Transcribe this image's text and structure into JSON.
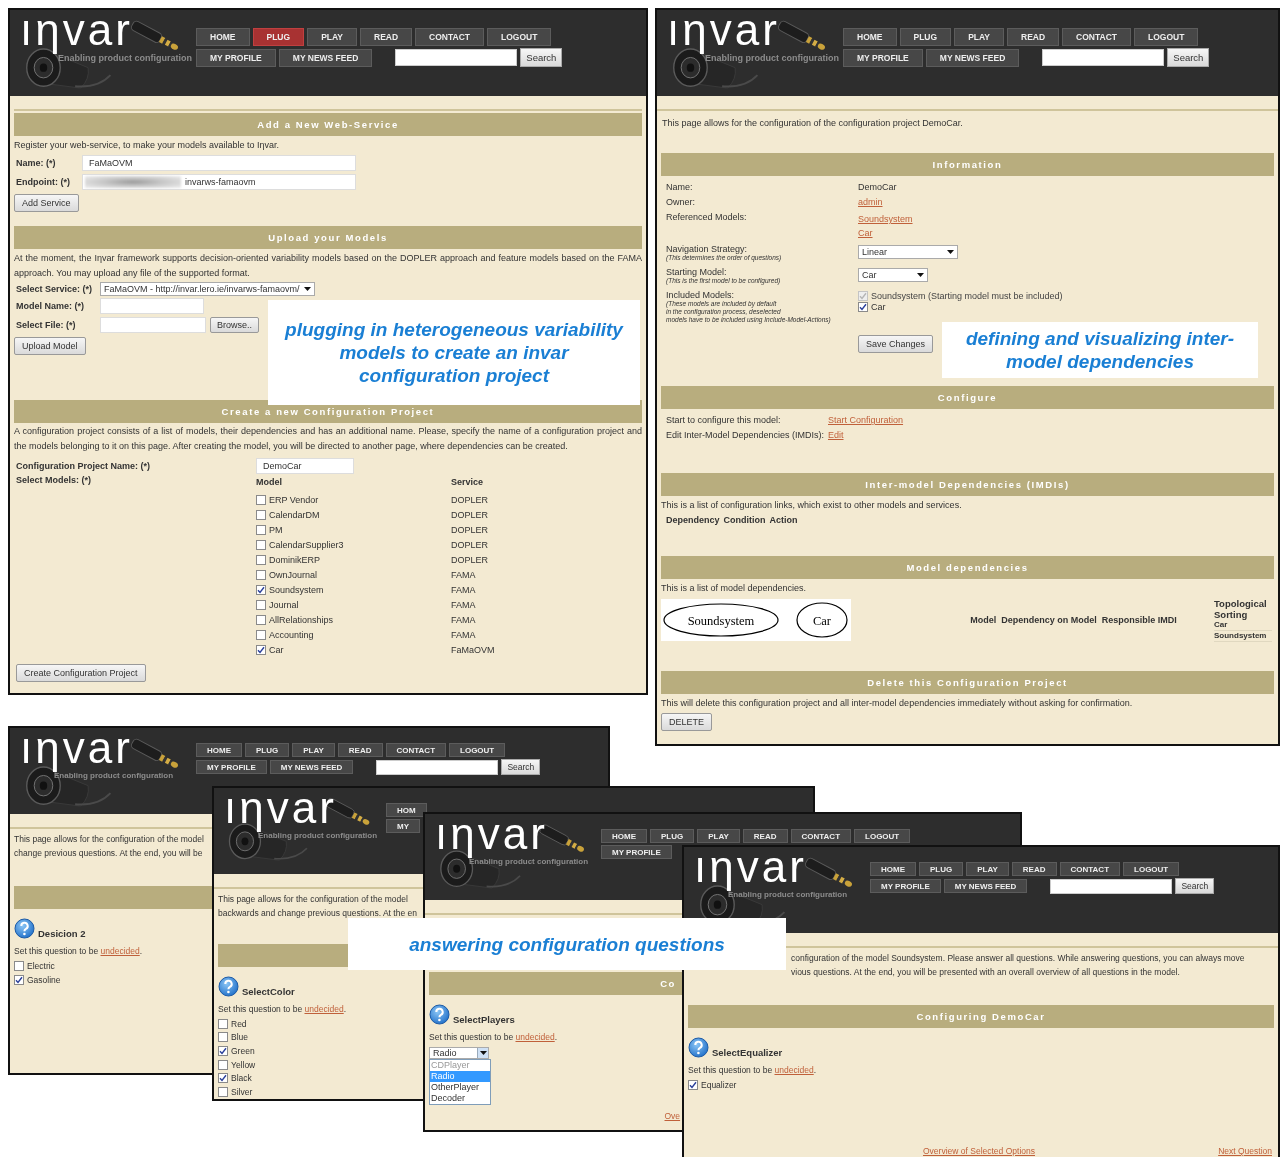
{
  "windows": [
    {
      "kind": "plug",
      "header": {
        "logo": "ıηvar",
        "tagline": "Enabling product configuration",
        "nav_row_1": [
          {
            "label": "HOME",
            "selected": false
          },
          {
            "label": "PLUG",
            "selected": true
          },
          {
            "label": "PLAY",
            "selected": false
          },
          {
            "label": "READ",
            "selected": false
          },
          {
            "label": "CONTACT",
            "selected": false
          },
          {
            "label": "LOGOUT",
            "selected": false
          }
        ],
        "nav_row_2": [
          {
            "label": "MY PROFILE",
            "selected": false
          },
          {
            "label": "MY NEWS FEED",
            "selected": false
          }
        ],
        "search": {
          "button": "Search"
        }
      },
      "add_service": {
        "title": "Add a New Web-Service",
        "text": "Register your web-service, to make your models available to Iηvar.",
        "name_label": "Name: (*)",
        "name_value": "FaMaOVM",
        "endpoint_label": "Endpoint: (*)",
        "endpoint_value": "invarws-famaovm",
        "button": "Add Service"
      },
      "upload": {
        "title": "Upload your Models",
        "text": "At the moment, the Iηvar framework supports decision-oriented variability models based on the DOPLER approach and feature models based on the FAMA approach. You may upload any file of the supported format.",
        "service_label": "Select Service: (*)",
        "service_value": "FaMaOVM - http://invar.lero.ie/invarws-famaovm/",
        "model_name_label": "Model Name: (*)",
        "file_label": "Select File: (*)",
        "browse_button": "Browse..",
        "button": "Upload Model"
      },
      "create": {
        "title": "Create a new Configuration Project",
        "text": "A configuration project consists of a list of models, their dependencies and has an additional name. Please, specify the name of a configuration project and the models belonging to it on this page. After creating the model, you will be directed to another page, where dependencies can be created.",
        "name_label": "Configuration Project Name: (*)",
        "name_value": "DemoCar",
        "models_label": "Select Models: (*)",
        "columns": [
          "Model",
          "Service"
        ],
        "models": [
          {
            "name": "ERP Vendor",
            "service": "DOPLER",
            "checked": false
          },
          {
            "name": "CalendarDM",
            "service": "DOPLER",
            "checked": false
          },
          {
            "name": "PM",
            "service": "DOPLER",
            "checked": false
          },
          {
            "name": "CalendarSupplier3",
            "service": "DOPLER",
            "checked": false
          },
          {
            "name": "DominikERP",
            "service": "DOPLER",
            "checked": false
          },
          {
            "name": "OwnJournal",
            "service": "FAMA",
            "checked": false
          },
          {
            "name": "Soundsystem",
            "service": "FAMA",
            "checked": true
          },
          {
            "name": "Journal",
            "service": "FAMA",
            "checked": false
          },
          {
            "name": "AllRelationships",
            "service": "FAMA",
            "checked": false
          },
          {
            "name": "Accounting",
            "service": "FAMA",
            "checked": false
          },
          {
            "name": "Car",
            "service": "FaMaOVM",
            "checked": true
          }
        ],
        "button": "Create Configuration Project"
      }
    },
    {
      "kind": "project",
      "header": {
        "logo": "ıηvar",
        "tagline": "Enabling product configuration",
        "nav_row_1": [
          {
            "label": "HOME",
            "selected": false
          },
          {
            "label": "PLUG",
            "selected": false
          },
          {
            "label": "PLAY",
            "selected": false
          },
          {
            "label": "READ",
            "selected": false
          },
          {
            "label": "CONTACT",
            "selected": false
          },
          {
            "label": "LOGOUT",
            "selected": false
          }
        ],
        "nav_row_2": [
          {
            "label": "MY PROFILE",
            "selected": false
          },
          {
            "label": "MY NEWS FEED",
            "selected": false
          }
        ],
        "search": {
          "button": "Search"
        }
      },
      "intro": "This page allows for the configuration of the configuration project DemoCar.",
      "information": {
        "title": "Information",
        "name_label": "Name:",
        "name_value": "DemoCar",
        "owner_label": "Owner:",
        "owner_link": "admin",
        "models_label": "Referenced Models:",
        "model_links": [
          "Soundsystem",
          "Car"
        ],
        "strategy_label": "Navigation Strategy:",
        "strategy_hint": "(This determines the order of questions)",
        "strategy_value": "Linear",
        "start_label": "Starting Model:",
        "start_hint": "(This is the first model to be configured)",
        "start_value": "Car",
        "included_label": "Included Models:",
        "included_hint": [
          "(These models are included by default",
          "in the configuration process, deselected",
          "models have to be included using Include-Model-Actions)"
        ],
        "included": [
          {
            "label": "Soundsystem (Starting model must be included)",
            "checked": true,
            "disabled": true
          },
          {
            "label": "Car",
            "checked": true,
            "disabled": false
          }
        ],
        "button": "Save Changes"
      },
      "configure": {
        "title": "Configure",
        "rows": [
          {
            "label": "Start to configure this model:",
            "link": "Start Configuration"
          },
          {
            "label": "Edit Inter-Model Dependencies (IMDIs):",
            "link": "Edit"
          }
        ]
      },
      "imdis": {
        "title": "Inter-model Dependencies (IMDIs)",
        "text": "This is a list of configuration links, which exist to other models and services.",
        "columns": [
          "Dependency",
          "Condition",
          "Action"
        ]
      },
      "model_dependencies": {
        "title": "Model dependencies",
        "text": "This is a list of model dependencies.",
        "graph_nodes": [
          "Soundsystem",
          "Car"
        ],
        "columns": [
          "Model",
          "Dependency on Model",
          "Responsible IMDI"
        ],
        "sorting_title": "Topological Sorting",
        "sorting": [
          "Car",
          "Soundsystem"
        ]
      },
      "delete": {
        "title": "Delete this Configuration Project",
        "text": "This will delete this configuration project and all inter-model dependencies immediately without asking for confirmation.",
        "button": "DELETE"
      }
    },
    {
      "kind": "question",
      "header": {
        "logo": "ıηvar",
        "tagline": "Enabling product configuration",
        "nav_row_1": [
          {
            "label": "HOME",
            "selected": false
          },
          {
            "label": "PLUG",
            "selected": false
          },
          {
            "label": "PLAY",
            "selected": false
          },
          {
            "label": "READ",
            "selected": false
          },
          {
            "label": "CONTACT",
            "selected": false
          },
          {
            "label": "LOGOUT",
            "selected": false
          }
        ],
        "nav_row_2": [
          {
            "label": "MY PROFILE",
            "selected": false
          },
          {
            "label": "MY NEWS FEED",
            "selected": false
          }
        ],
        "search": {
          "button": "Search"
        }
      },
      "intro": [
        "This page allows for the configuration of the model",
        "change previous questions. At the end, you will be"
      ],
      "question": {
        "title": "Desicion 2",
        "prompt": "Set this question to be",
        "link": "undecided",
        "prompt_end": ".",
        "kind": "checkboxes",
        "options": [
          {
            "label": "Electric",
            "checked": false
          },
          {
            "label": "Gasoline",
            "checked": true
          }
        ]
      }
    },
    {
      "kind": "question",
      "header": {
        "logo": "ıηvar",
        "tagline": "Enabling product configuration",
        "nav_row_1": [
          {
            "label": "HOM",
            "selected": false
          }
        ],
        "nav_row_2": [
          {
            "label": "MY",
            "selected": false
          }
        ]
      },
      "intro": [
        "This page allows for the configuration of the model",
        "backwards and change previous questions. At the en"
      ],
      "question": {
        "title": "SelectColor",
        "prompt": "Set this question to be",
        "link": "undecided",
        "prompt_end": ".",
        "kind": "checkboxes",
        "options": [
          {
            "label": "Red",
            "checked": false
          },
          {
            "label": "Blue",
            "checked": false
          },
          {
            "label": "Green",
            "checked": true
          },
          {
            "label": "Yellow",
            "checked": false
          },
          {
            "label": "Black",
            "checked": true
          },
          {
            "label": "Silver",
            "checked": false
          }
        ]
      }
    },
    {
      "kind": "question",
      "header": {
        "logo": "ıηvar",
        "tagline": "Enabling product configuration",
        "nav_row_1": [
          {
            "label": "HOME",
            "selected": false
          },
          {
            "label": "PLUG",
            "selected": false
          },
          {
            "label": "PLAY",
            "selected": false
          },
          {
            "label": "READ",
            "selected": false
          },
          {
            "label": "CONTACT",
            "selected": false
          },
          {
            "label": "LOGOUT",
            "selected": false
          }
        ],
        "nav_row_2": [
          {
            "label": "MY PROFILE",
            "selected": false
          }
        ]
      },
      "section_title": "Co",
      "question": {
        "title": "SelectPlayers",
        "prompt": "Set this question to be",
        "link": "undecided",
        "prompt_end": ".",
        "kind": "dropdown",
        "value": "Radio",
        "options": [
          {
            "label": "CDPlayer",
            "selected": false,
            "disabled": true
          },
          {
            "label": "Radio",
            "selected": true,
            "disabled": false
          },
          {
            "label": "OtherPlayer",
            "selected": false,
            "disabled": false
          },
          {
            "label": "Decoder",
            "selected": false,
            "disabled": false
          }
        ]
      },
      "links": [
        "Ove"
      ]
    },
    {
      "kind": "question",
      "header": {
        "logo": "ıηvar",
        "tagline": "Enabling product configuration",
        "nav_row_1": [
          {
            "label": "HOME",
            "selected": false
          },
          {
            "label": "PLUG",
            "selected": false
          },
          {
            "label": "PLAY",
            "selected": false
          },
          {
            "label": "READ",
            "selected": false
          },
          {
            "label": "CONTACT",
            "selected": false
          },
          {
            "label": "LOGOUT",
            "selected": false
          }
        ],
        "nav_row_2": [
          {
            "label": "MY PROFILE",
            "selected": false
          },
          {
            "label": "MY NEWS FEED",
            "selected": false
          }
        ],
        "search": {
          "button": "Search"
        }
      },
      "intro": [
        "configuration of the model Soundsystem. Please answer all questions. While answering questions, you can always move",
        "vious questions. At the end, you will be presented with an overall overview of all questions in the model."
      ],
      "section_title": "Configuring DemoCar",
      "question": {
        "title": "SelectEqualizer",
        "prompt": "Set this question to be",
        "link": "undecided",
        "prompt_end": ".",
        "kind": "checkboxes",
        "options": [
          {
            "label": "Equalizer",
            "checked": true
          }
        ]
      },
      "links": [
        "Overview of Selected Options",
        "Next Question"
      ]
    }
  ],
  "callouts": [
    {
      "text": "plugging in heterogeneous variability models to create an invar configuration project"
    },
    {
      "text": "defining and visualizing inter-model dependencies"
    },
    {
      "text": "answering configuration questions"
    }
  ]
}
